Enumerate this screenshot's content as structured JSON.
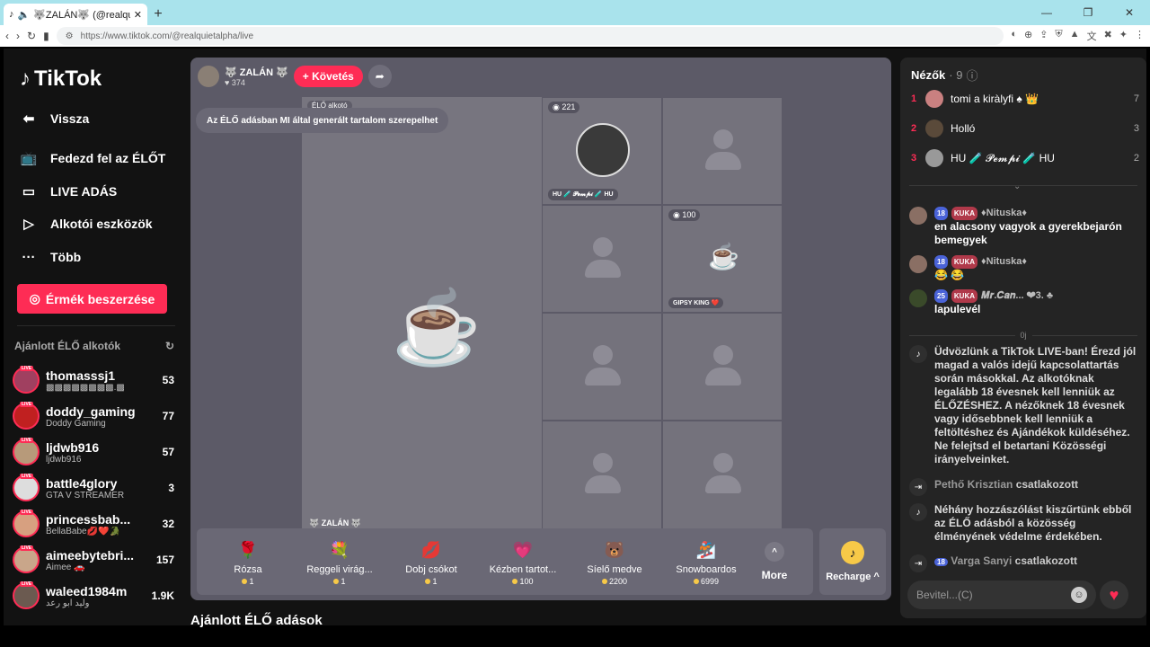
{
  "browser": {
    "tab_title": "🐺ZALÁN🐺 (@realquietalph",
    "url": "https://www.tiktok.com/@realquietalpha/live"
  },
  "sidebar": {
    "logo": "TikTok",
    "nav": [
      {
        "label": "Vissza",
        "icon": "back-arrow-icon"
      },
      {
        "label": "Fedezd fel az ÉLŐT",
        "icon": "tv-icon"
      },
      {
        "label": "LIVE ADÁS",
        "icon": "camera-icon"
      },
      {
        "label": "Alkotói eszközök",
        "icon": "play-circle-icon"
      },
      {
        "label": "Több",
        "icon": "more-icon"
      }
    ],
    "coins_button": "Érmék beszerzése",
    "suggested_title": "Ajánlott ÉLŐ alkotók",
    "live_label": "LIVE",
    "creators": [
      {
        "name": "thomasssj1",
        "sub": "▩▩▩▩▩▩▩▩.▩",
        "count": "53"
      },
      {
        "name": "doddy_gaming",
        "sub": "Doddy Gaming",
        "count": "77"
      },
      {
        "name": "ljdwb916",
        "sub": "ljdwb916",
        "count": "57"
      },
      {
        "name": "battle4glory",
        "sub": "GTA V STREAMER",
        "count": "3"
      },
      {
        "name": "princessbab...",
        "sub": "BellaBabe💋❤️🐊",
        "count": "32"
      },
      {
        "name": "aimeebytebri...",
        "sub": "Aimee 🚗",
        "count": "157"
      },
      {
        "name": "waleed1984m",
        "sub": "وليد ابو رعد",
        "count": "1.9K"
      }
    ]
  },
  "stage": {
    "host_name": "🐺 ZALÁN 🐺",
    "host_likes": "♥ 374",
    "follow_label": "+ Követés",
    "ai_banner": "Az ÉLŐ adásban MI által generált tartalom szerepelhet",
    "main_tag": "ÉLŐ alkotó",
    "main_name": "🐺 ZALÁN 🐺",
    "cells": [
      {
        "badge": "◉ 221",
        "name": "HU 🧪 𝓟𝓮𝓶𝓹𝓲 🧪 HU"
      },
      {
        "badge": "",
        "name": ""
      },
      {
        "badge": "",
        "name": ""
      },
      {
        "badge": "◉ 100",
        "name": "GIPSY KING ❤️"
      },
      {
        "badge": "",
        "name": ""
      },
      {
        "badge": "",
        "name": ""
      },
      {
        "badge": "",
        "name": ""
      },
      {
        "badge": "",
        "name": ""
      }
    ],
    "gifts": [
      {
        "name": "Rózsa",
        "price": "1",
        "icon": "🌹"
      },
      {
        "name": "Reggeli virág...",
        "price": "1",
        "icon": "💐"
      },
      {
        "name": "Dobj csókot",
        "price": "1",
        "icon": "💋"
      },
      {
        "name": "Kézben tartot...",
        "price": "100",
        "icon": "💗"
      },
      {
        "name": "Síelő medve",
        "price": "2200",
        "icon": "🐻"
      },
      {
        "name": "Snowboardos",
        "price": "6999",
        "icon": "🏂"
      }
    ],
    "more_label": "More",
    "recharge_label": "Recharge ^"
  },
  "bottom_title": "Ajánlott ÉLŐ adások",
  "chat": {
    "viewers_label": "Nézők",
    "viewers_count": "· 9",
    "viewers": [
      {
        "rank": "1",
        "name": "tomi a kiràlyfi ♠ 👑",
        "count": "7"
      },
      {
        "rank": "2",
        "name": "Holló",
        "count": "3"
      },
      {
        "rank": "3",
        "name": "HU 🧪 𝓟𝓮𝓶𝓹𝓲 🧪 HU",
        "count": "2"
      }
    ],
    "messages": [
      {
        "level": "18",
        "kuka": "KUKA",
        "user": "♦Nituska♦",
        "text": "en alacsony vagyok a gyerekbejarón bemegyek"
      },
      {
        "level": "18",
        "kuka": "KUKA",
        "user": "♦Nituska♦",
        "text": "😂 😂"
      },
      {
        "level": "25",
        "kuka": "KUKA",
        "user": "𝑴𝒓.𝑪𝒂𝒏... ❤3. ♣",
        "text": "lapulevél"
      }
    ],
    "timeline": "0j",
    "welcome": "Üdvözlünk a TikTok LIVE-ban! Érezd jól magad a valós idejű kapcsolattartás során másokkal. Az alkotóknak legalább 18 évesnek kell lenniük az ÉLŐZÉSHEZ. A nézőknek 18 évesnek vagy idősebbnek kell lenniük a feltöltéshez és Ajándékok küldéséhez. Ne felejtsd el betartani Közösségi irányelveinket.",
    "join1_name": "Pethő Krisztian",
    "join1_text": "csatlakozott",
    "filter_note": "Néhány hozzászólást kiszűrtünk ebből az ÉLŐ adásból a közösség élményének védelme érdekében.",
    "join2_level": "18",
    "join2_name": "Varga Sanyi",
    "join2_text": "csatlakozott",
    "input_placeholder": "Bevitel...(C)"
  }
}
